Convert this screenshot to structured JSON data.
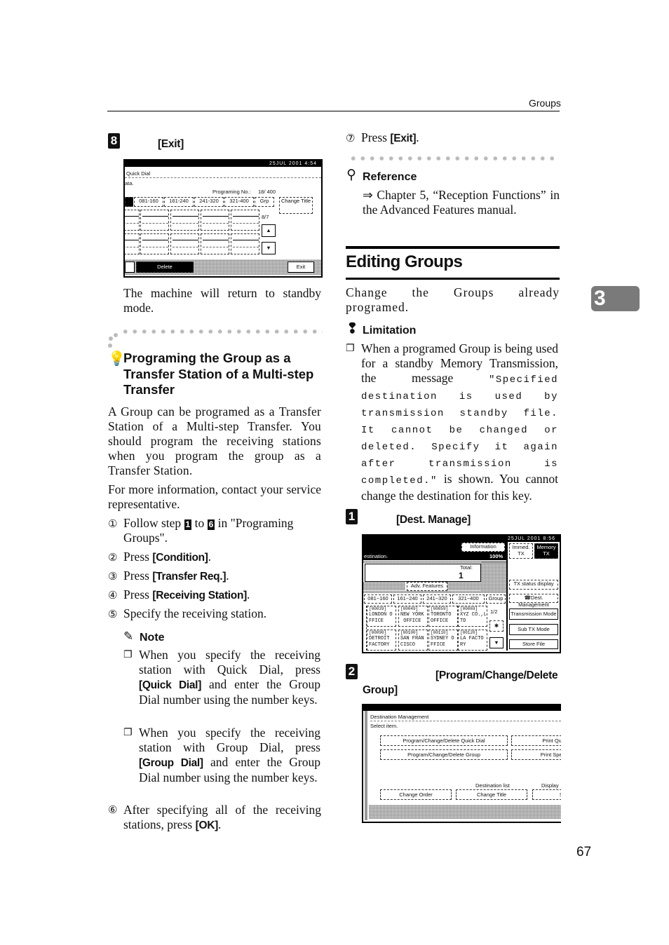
{
  "header": {
    "running_head": "Groups",
    "chapter_tab": "3",
    "page_number": "67"
  },
  "left_column": {
    "step8": {
      "number": "8",
      "key": "[Exit]",
      "screen": {
        "date": "25JUL  2001   4:54",
        "title": "Quick Dial",
        "subtitle": "ata.",
        "prog_label": "Programing No.:",
        "prog_value": "18/ 400",
        "tabs": [
          "",
          "081-160",
          "161-240",
          "241-320",
          "321-400",
          "Grp"
        ],
        "change_title": "Change Title",
        "page": "8/7",
        "up": "▲",
        "down": "▼",
        "delete": "Delete",
        "exit": "Exit"
      },
      "result": "The machine will return to standby mode."
    },
    "tip": {
      "title": "Programing the Group as a Transfer Station of a Multi-step Transfer",
      "para1": "A Group can be programed as a Transfer Station of a Multi-step Transfer. You should program the receiving stations when you program the group as a Transfer Station.",
      "para2": "For more information, contact your service representative.",
      "steps": [
        {
          "num": "①",
          "pre": "Follow step ",
          "badge1": "1",
          "mid": " to ",
          "badge2": "6",
          "post": " in \"Programing Groups\"."
        },
        {
          "num": "②",
          "pre": "Press ",
          "key": "[Condition]",
          "post": "."
        },
        {
          "num": "③",
          "pre": "Press ",
          "key": "[Transfer Req.]",
          "post": "."
        },
        {
          "num": "④",
          "pre": "Press ",
          "key": "[Receiving Station]",
          "post": "."
        },
        {
          "num": "⑤",
          "text": "Specify the receiving station."
        }
      ],
      "note": {
        "title": "Note",
        "items": [
          {
            "pre": "When you specify the receiving station with Quick Dial, press ",
            "key": "[Quick Dial]",
            "post": " and enter the Group Dial number using the number keys."
          },
          {
            "pre": "When you specify the receiving station with Group Dial, press ",
            "key": "[Group Dial]",
            "post": " and enter the Group Dial number using the number keys."
          }
        ]
      },
      "step6": {
        "num": "⑥",
        "pre": "After specifying all of the receiving stations, press ",
        "key": "[OK]",
        "post": "."
      }
    }
  },
  "right_column": {
    "step7": {
      "num": "⑦",
      "pre": "Press ",
      "key": "[Exit]",
      "post": "."
    },
    "reference": {
      "title": "Reference",
      "text": "⇒ Chapter 5, “Reception Functions” in the Advanced Features manual."
    },
    "section_title": "Editing Groups",
    "intro": "Change the Groups already programed.",
    "limitation": {
      "title": "Limitation",
      "pre": "When a programed Group is being used for a standby Memory Transmission, the message ",
      "mono": "\"Specified destination is used by transmission standby file. It cannot be changed or deleted. Specify it again after transmission is completed.\"",
      "post": " is shown. You cannot change the destination for this key."
    },
    "step1": {
      "number": "1",
      "key": "[Dest. Manage]",
      "screen": {
        "date": "25JUL  2001   8:56",
        "information": "Information",
        "status": "estination.",
        "percent": "100%",
        "immed": "Immed. TX",
        "memory": "Memory TX",
        "total_label": "Total:",
        "total_value": "1",
        "adv_features": "Adv. Features",
        "tx_status": "TX status display",
        "tabs": [
          "081~160",
          "161~240",
          "241~320",
          "321~400",
          "Group"
        ],
        "dest_management": "☎Dest. Management",
        "transmission_mode": "Transmission Mode",
        "sub_tx_mode": "Sub TX Mode",
        "store_file": "Store File",
        "page": "1/2",
        "entries": [
          {
            "code": "[00039]",
            "line1": "LONDON O",
            "line2": "FFICE"
          },
          {
            "code": "[00049]",
            "line1": "NEW YORK",
            "line2": " OFFICE"
          },
          {
            "code": "[00059]",
            "line1": "TORONTO",
            "line2": "OFFICE"
          },
          {
            "code": "[00069]",
            "line1": "XYZ CO.,L",
            "line2": "TD"
          },
          {
            "code": "[00090]",
            "line1": "DETROIT",
            "line2": "FACTORY"
          },
          {
            "code": "[00100]",
            "line1": "SAN FRAN",
            "line2": "CISCO"
          },
          {
            "code": "[00110]",
            "line1": "SYDNEY O",
            "line2": "FFICE"
          },
          {
            "code": "[00120]",
            "line1": "LA FACTO",
            "line2": "RY"
          }
        ]
      }
    },
    "step2": {
      "number": "2",
      "key": "[Program/Change/Delete Group]",
      "screen": {
        "title": "Destination Management",
        "subtitle": "Select item.",
        "btn_quick": "Program/Change/Delete Quick Dial",
        "btn_group": "Program/Change/Delete Group",
        "print_quick": "Print Quick",
        "print_speed": "Print Speed",
        "dest_list": "Destination list",
        "display": "Display",
        "change_order": "Change Order",
        "change_title": "Change Title",
        "switch": "Swi"
      }
    }
  }
}
